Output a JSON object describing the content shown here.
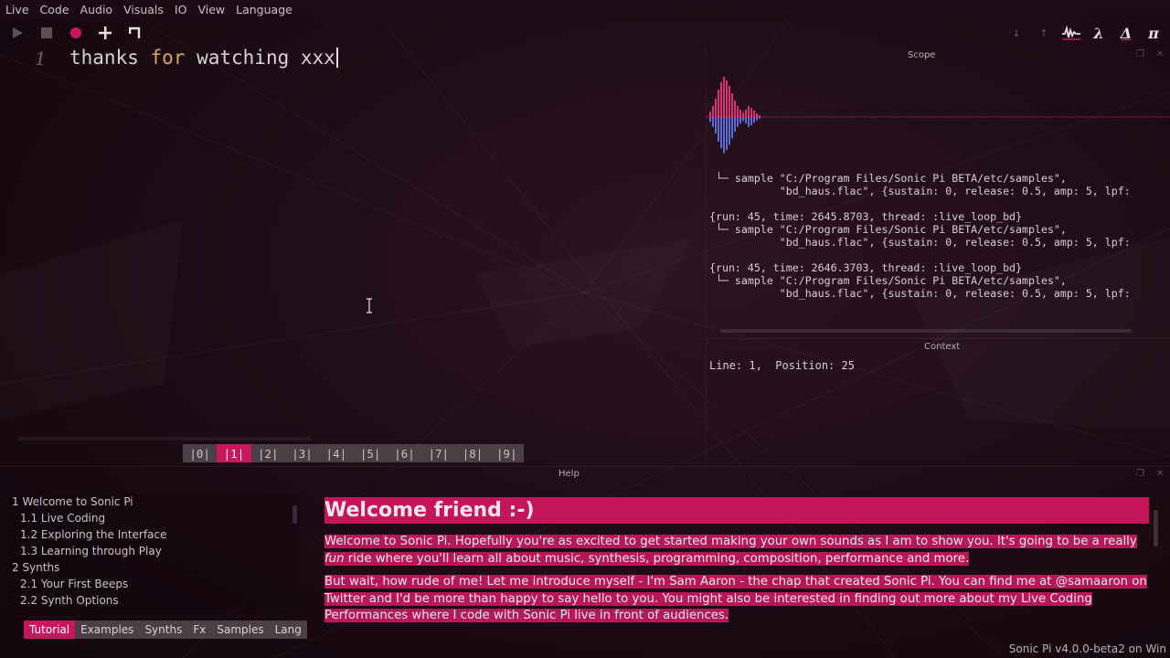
{
  "menu": [
    "Live",
    "Code",
    "Audio",
    "Visuals",
    "IO",
    "View",
    "Language"
  ],
  "toolbar": {
    "run_icon": "play-icon",
    "stop_icon": "stop-icon",
    "record_icon": "record-icon",
    "size_up_icon": "plus-icon",
    "size_down_icon": "corner-icon"
  },
  "right_tools": {
    "down_arrow": "↓",
    "up_arrow": "↑",
    "scope_icon": "scope-wave-icon",
    "lambda": "λ",
    "delta": "Δ",
    "pi": "π"
  },
  "editor": {
    "line_number": "1",
    "code_keyword_prefix": "thanks ",
    "code_keyword": "for",
    "code_rest": " watching xxx"
  },
  "scope": {
    "title": "Scope"
  },
  "log": {
    "lines": [
      " └─ sample \"C:/Program Files/Sonic Pi BETA/etc/samples\",",
      "           \"bd_haus.flac\", {sustain: 0, release: 0.5, amp: 5, lpf:",
      "",
      "{run: 45, time: 2645.8703, thread: :live_loop_bd}",
      " └─ sample \"C:/Program Files/Sonic Pi BETA/etc/samples\",",
      "           \"bd_haus.flac\", {sustain: 0, release: 0.5, amp: 5, lpf:",
      "",
      "{run: 45, time: 2646.3703, thread: :live_loop_bd}",
      " └─ sample \"C:/Program Files/Sonic Pi BETA/etc/samples\",",
      "           \"bd_haus.flac\", {sustain: 0, release: 0.5, amp: 5, lpf:"
    ]
  },
  "context": {
    "title": "Context",
    "text": "Line: 1,  Position: 25"
  },
  "buffers": [
    "|0|",
    "|1|",
    "|2|",
    "|3|",
    "|4|",
    "|5|",
    "|6|",
    "|7|",
    "|8|",
    "|9|"
  ],
  "active_buffer": 1,
  "help": {
    "title": "Help",
    "toc": [
      {
        "label": "1 Welcome to Sonic Pi",
        "level": 0
      },
      {
        "label": "1.1 Live Coding",
        "level": 1
      },
      {
        "label": "1.2 Exploring the Interface",
        "level": 1
      },
      {
        "label": "1.3 Learning through Play",
        "level": 1
      },
      {
        "label": "2 Synths",
        "level": 0
      },
      {
        "label": "2.1 Your First Beeps",
        "level": 1
      },
      {
        "label": "2.2 Synth Options",
        "level": 1
      }
    ],
    "tabs": [
      "Tutorial",
      "Examples",
      "Synths",
      "Fx",
      "Samples",
      "Lang"
    ],
    "active_tab": 0,
    "doc_heading": "Welcome friend :-)",
    "para1_a": "Welcome to Sonic Pi. Hopefully you're as excited to get started making your own sounds as I am to show you. It's going to be a really ",
    "para1_em": "fun",
    "para1_b": " ride where you'll learn all about music, synthesis, programming, composition, performance and more.",
    "para2": "But wait, how rude of me! Let me introduce myself - I'm Sam Aaron - the chap that created Sonic Pi. You can find me at @samaaron on Twitter and I'd be more than happy to say hello to you. You might also be interested in finding out more about my Live Coding Performances where I code with Sonic Pi live in front of audiences."
  },
  "status": "Sonic Pi v4.0.0-beta2 on Win",
  "colors": {
    "accent": "#c8175f",
    "keyword": "#d9a55a",
    "scope_top": "#d8336e",
    "scope_bottom": "#5a6ad8"
  }
}
